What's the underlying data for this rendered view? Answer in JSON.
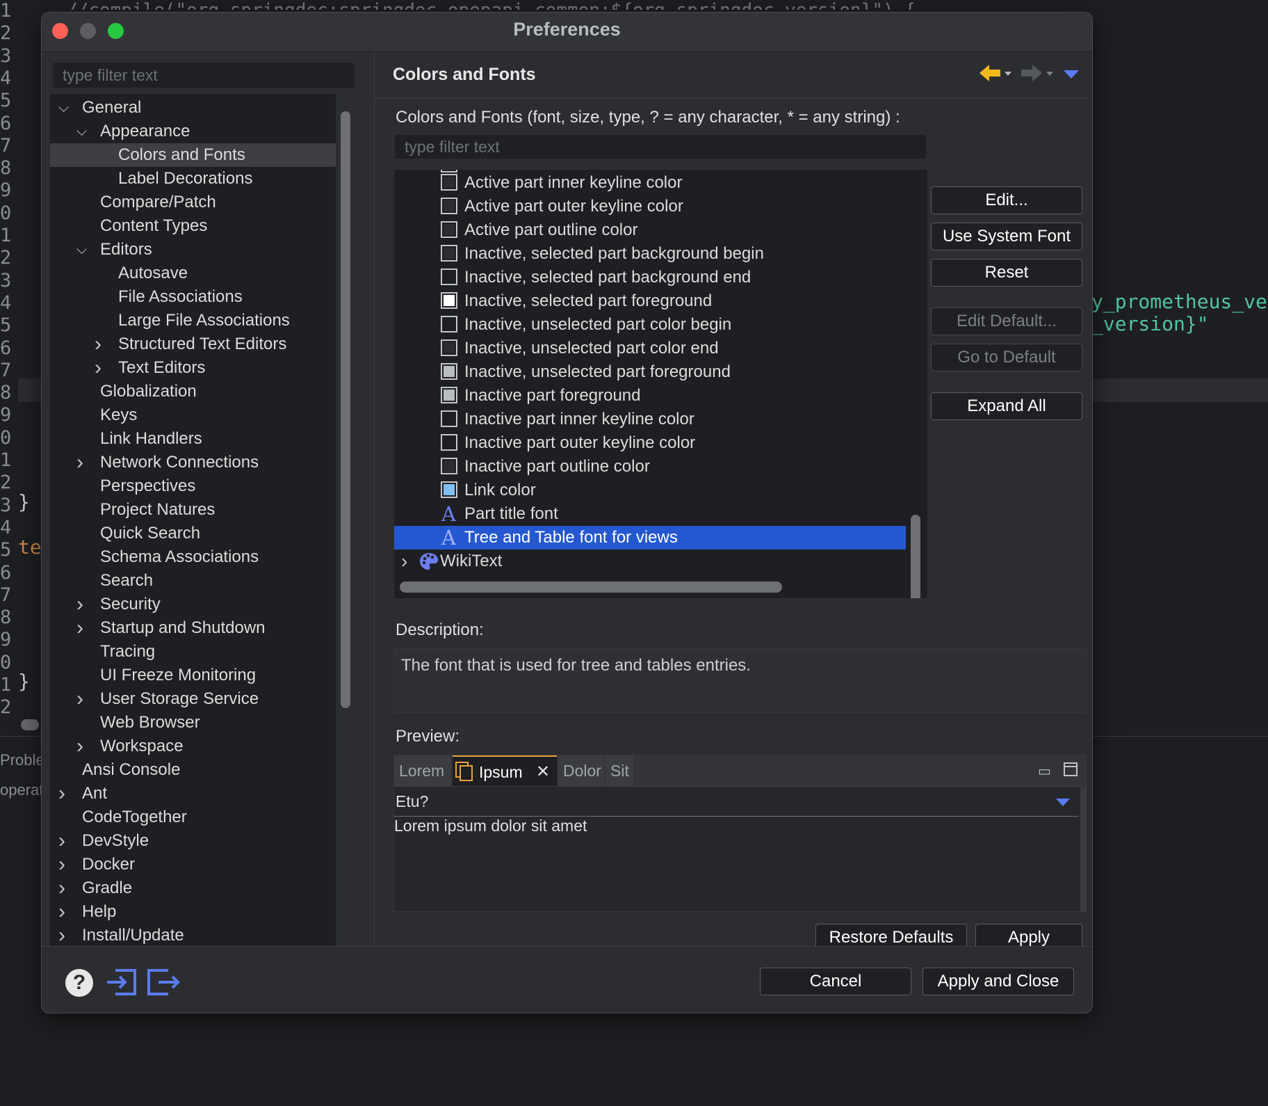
{
  "window": {
    "title": "Preferences"
  },
  "editor_bg": {
    "top_snippet": "//compile(\"org.springdoc:springdoc-openapi-common:${org_springdoc_version}\") {",
    "gutter": [
      "1",
      "2",
      "3",
      "4",
      "5",
      "6",
      "7",
      "8",
      "9",
      "0",
      "1",
      "2",
      "3",
      "4",
      "5",
      "6",
      "7",
      "8",
      "9",
      "0",
      "1",
      "2",
      "3",
      "4",
      "5",
      "6",
      "7",
      "8",
      "9",
      "0",
      "1",
      "2"
    ],
    "code_line_1": "y_prometheus_ve",
    "code_line_2": "_version}\"",
    "brace": "}",
    "te": "te",
    "problems_tab": "Proble",
    "operat": "operat"
  },
  "left": {
    "filter_placeholder": "type filter text",
    "tree": [
      {
        "label": "General",
        "indent": 0,
        "expander": "open"
      },
      {
        "label": "Appearance",
        "indent": 1,
        "expander": "open"
      },
      {
        "label": "Colors and Fonts",
        "indent": 2,
        "expander": "none",
        "selected": true
      },
      {
        "label": "Label Decorations",
        "indent": 2,
        "expander": "none"
      },
      {
        "label": "Compare/Patch",
        "indent": 1,
        "expander": "none"
      },
      {
        "label": "Content Types",
        "indent": 1,
        "expander": "none"
      },
      {
        "label": "Editors",
        "indent": 1,
        "expander": "open"
      },
      {
        "label": "Autosave",
        "indent": 2,
        "expander": "none"
      },
      {
        "label": "File Associations",
        "indent": 2,
        "expander": "none"
      },
      {
        "label": "Large File Associations",
        "indent": 2,
        "expander": "none"
      },
      {
        "label": "Structured Text Editors",
        "indent": 2,
        "expander": "closed"
      },
      {
        "label": "Text Editors",
        "indent": 2,
        "expander": "closed"
      },
      {
        "label": "Globalization",
        "indent": 1,
        "expander": "none"
      },
      {
        "label": "Keys",
        "indent": 1,
        "expander": "none"
      },
      {
        "label": "Link Handlers",
        "indent": 1,
        "expander": "none"
      },
      {
        "label": "Network Connections",
        "indent": 1,
        "expander": "closed"
      },
      {
        "label": "Perspectives",
        "indent": 1,
        "expander": "none"
      },
      {
        "label": "Project Natures",
        "indent": 1,
        "expander": "none"
      },
      {
        "label": "Quick Search",
        "indent": 1,
        "expander": "none"
      },
      {
        "label": "Schema Associations",
        "indent": 1,
        "expander": "none"
      },
      {
        "label": "Search",
        "indent": 1,
        "expander": "none"
      },
      {
        "label": "Security",
        "indent": 1,
        "expander": "closed"
      },
      {
        "label": "Startup and Shutdown",
        "indent": 1,
        "expander": "closed"
      },
      {
        "label": "Tracing",
        "indent": 1,
        "expander": "none"
      },
      {
        "label": "UI Freeze Monitoring",
        "indent": 1,
        "expander": "none"
      },
      {
        "label": "User Storage Service",
        "indent": 1,
        "expander": "closed"
      },
      {
        "label": "Web Browser",
        "indent": 1,
        "expander": "none"
      },
      {
        "label": "Workspace",
        "indent": 1,
        "expander": "closed"
      },
      {
        "label": "Ansi Console",
        "indent": 0,
        "expander": "none"
      },
      {
        "label": "Ant",
        "indent": 0,
        "expander": "closed"
      },
      {
        "label": "CodeTogether",
        "indent": 0,
        "expander": "none"
      },
      {
        "label": "DevStyle",
        "indent": 0,
        "expander": "closed"
      },
      {
        "label": "Docker",
        "indent": 0,
        "expander": "closed"
      },
      {
        "label": "Gradle",
        "indent": 0,
        "expander": "closed"
      },
      {
        "label": "Help",
        "indent": 0,
        "expander": "closed"
      },
      {
        "label": "Install/Update",
        "indent": 0,
        "expander": "closed"
      }
    ]
  },
  "right": {
    "title": "Colors and Fonts",
    "icons": [
      "back-arrow-icon",
      "forward-arrow-icon",
      "view-menu-icon"
    ],
    "label": "Colors and Fonts (font, size, type, ? = any character, * = any string) :",
    "filter_placeholder": "type filter text",
    "items": [
      {
        "label": "Active part inner keyline color",
        "kind": "color",
        "color": "#2b2d31"
      },
      {
        "label": "Active part outer keyline color",
        "kind": "color",
        "color": "#2b2d31"
      },
      {
        "label": "Active part outline color",
        "kind": "color",
        "color": "#2b2d31"
      },
      {
        "label": "Inactive, selected part background begin",
        "kind": "color",
        "color": "#2b2d31"
      },
      {
        "label": "Inactive, selected part background end",
        "kind": "color",
        "color": "#1e1f22"
      },
      {
        "label": "Inactive, selected part foreground",
        "kind": "color",
        "color": "#ffffff"
      },
      {
        "label": "Inactive, unselected part color begin",
        "kind": "color",
        "color": "#1e1f22"
      },
      {
        "label": "Inactive, unselected part color end",
        "kind": "color",
        "color": "#2b2d31"
      },
      {
        "label": "Inactive, unselected part foreground",
        "kind": "color",
        "color": "#b9bcc0"
      },
      {
        "label": "Inactive part foreground",
        "kind": "color",
        "color": "#b9bcc0"
      },
      {
        "label": "Inactive part inner keyline color",
        "kind": "color",
        "color": "#1e1f22"
      },
      {
        "label": "Inactive part outer keyline color",
        "kind": "color",
        "color": "#1e1f22"
      },
      {
        "label": "Inactive part outline color",
        "kind": "color",
        "color": "#2b2d31"
      },
      {
        "label": "Link color",
        "kind": "color",
        "color": "#7fbff5"
      },
      {
        "label": "Part title font",
        "kind": "font"
      },
      {
        "label": "Tree and Table font for views",
        "kind": "font",
        "selected": true
      },
      {
        "label": "WikiText",
        "kind": "category"
      }
    ],
    "buttons": {
      "edit": "Edit...",
      "use_system_font": "Use System Font",
      "reset": "Reset",
      "edit_default": "Edit Default...",
      "go_to_default": "Go to Default",
      "expand_all": "Expand All"
    },
    "description_label": "Description:",
    "description": "The font that is used for tree and tables entries.",
    "preview_label": "Preview:",
    "preview": {
      "tabs": [
        "Lorem",
        "Ipsum",
        "Dolor",
        "Sit"
      ],
      "active_tab": "Ipsum",
      "question": "Etu?",
      "body": "Lorem ipsum dolor sit amet"
    },
    "restore_defaults": "Restore Defaults",
    "apply": "Apply"
  },
  "footer": {
    "icons": [
      "help-icon",
      "import-icon",
      "export-icon"
    ],
    "cancel": "Cancel",
    "apply_and_close": "Apply and Close"
  }
}
